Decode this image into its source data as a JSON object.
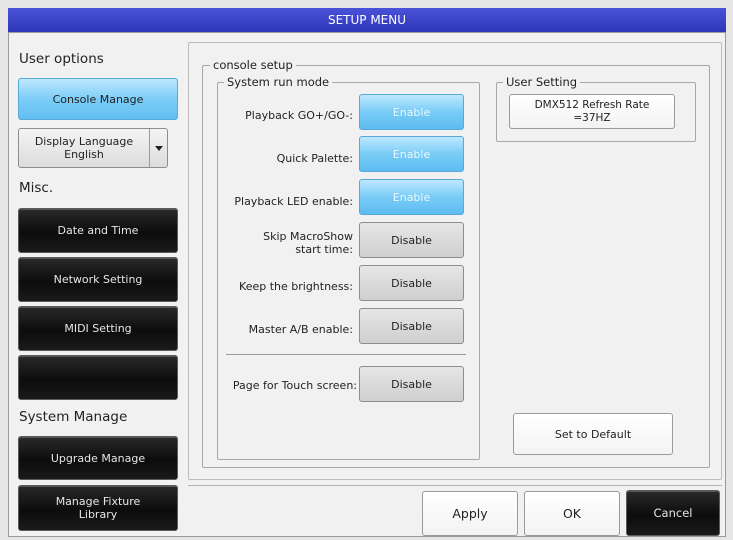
{
  "window": {
    "title": "SETUP MENU"
  },
  "sidebar": {
    "user_options_heading": "User options",
    "console_manage": "Console Manage",
    "display_language": {
      "label": "Display Language",
      "value": "English"
    },
    "misc_heading": "Misc.",
    "date_and_time": "Date and Time",
    "network_setting": "Network Setting",
    "midi_setting": "MIDI Setting",
    "blank_button": "",
    "system_manage_heading": "System Manage",
    "upgrade_manage": "Upgrade Manage",
    "manage_fixture_library": {
      "line1": "Manage Fixture",
      "line2": "Library"
    }
  },
  "console_setup": {
    "title": "console setup",
    "system_run_mode": {
      "title": "System run mode",
      "rows": [
        {
          "label": "Playback GO+/GO-:",
          "value": "Enable",
          "state": "on"
        },
        {
          "label": "Quick Palette:",
          "value": "Enable",
          "state": "on"
        },
        {
          "label": "Playback LED enable:",
          "value": "Enable",
          "state": "on"
        },
        {
          "label_line1": "Skip MacroShow",
          "label_line2": "start time:",
          "value": "Disable",
          "state": "off"
        },
        {
          "label": "Keep the brightness:",
          "value": "Disable",
          "state": "off"
        },
        {
          "label": "Master A/B enable:",
          "value": "Disable",
          "state": "off"
        },
        {
          "label": "Page for Touch screen:",
          "value": "Disable",
          "state": "off"
        }
      ]
    },
    "user_setting": {
      "title": "User Setting",
      "dmx_line1": "DMX512 Refresh Rate",
      "dmx_line2": "=37HZ"
    },
    "set_to_default": "Set to Default"
  },
  "footer": {
    "apply": "Apply",
    "ok": "OK",
    "cancel": "Cancel"
  },
  "colors": {
    "title_bar": "#3a43c8",
    "enabled": "#62bff1",
    "dark_button": "#111111"
  }
}
